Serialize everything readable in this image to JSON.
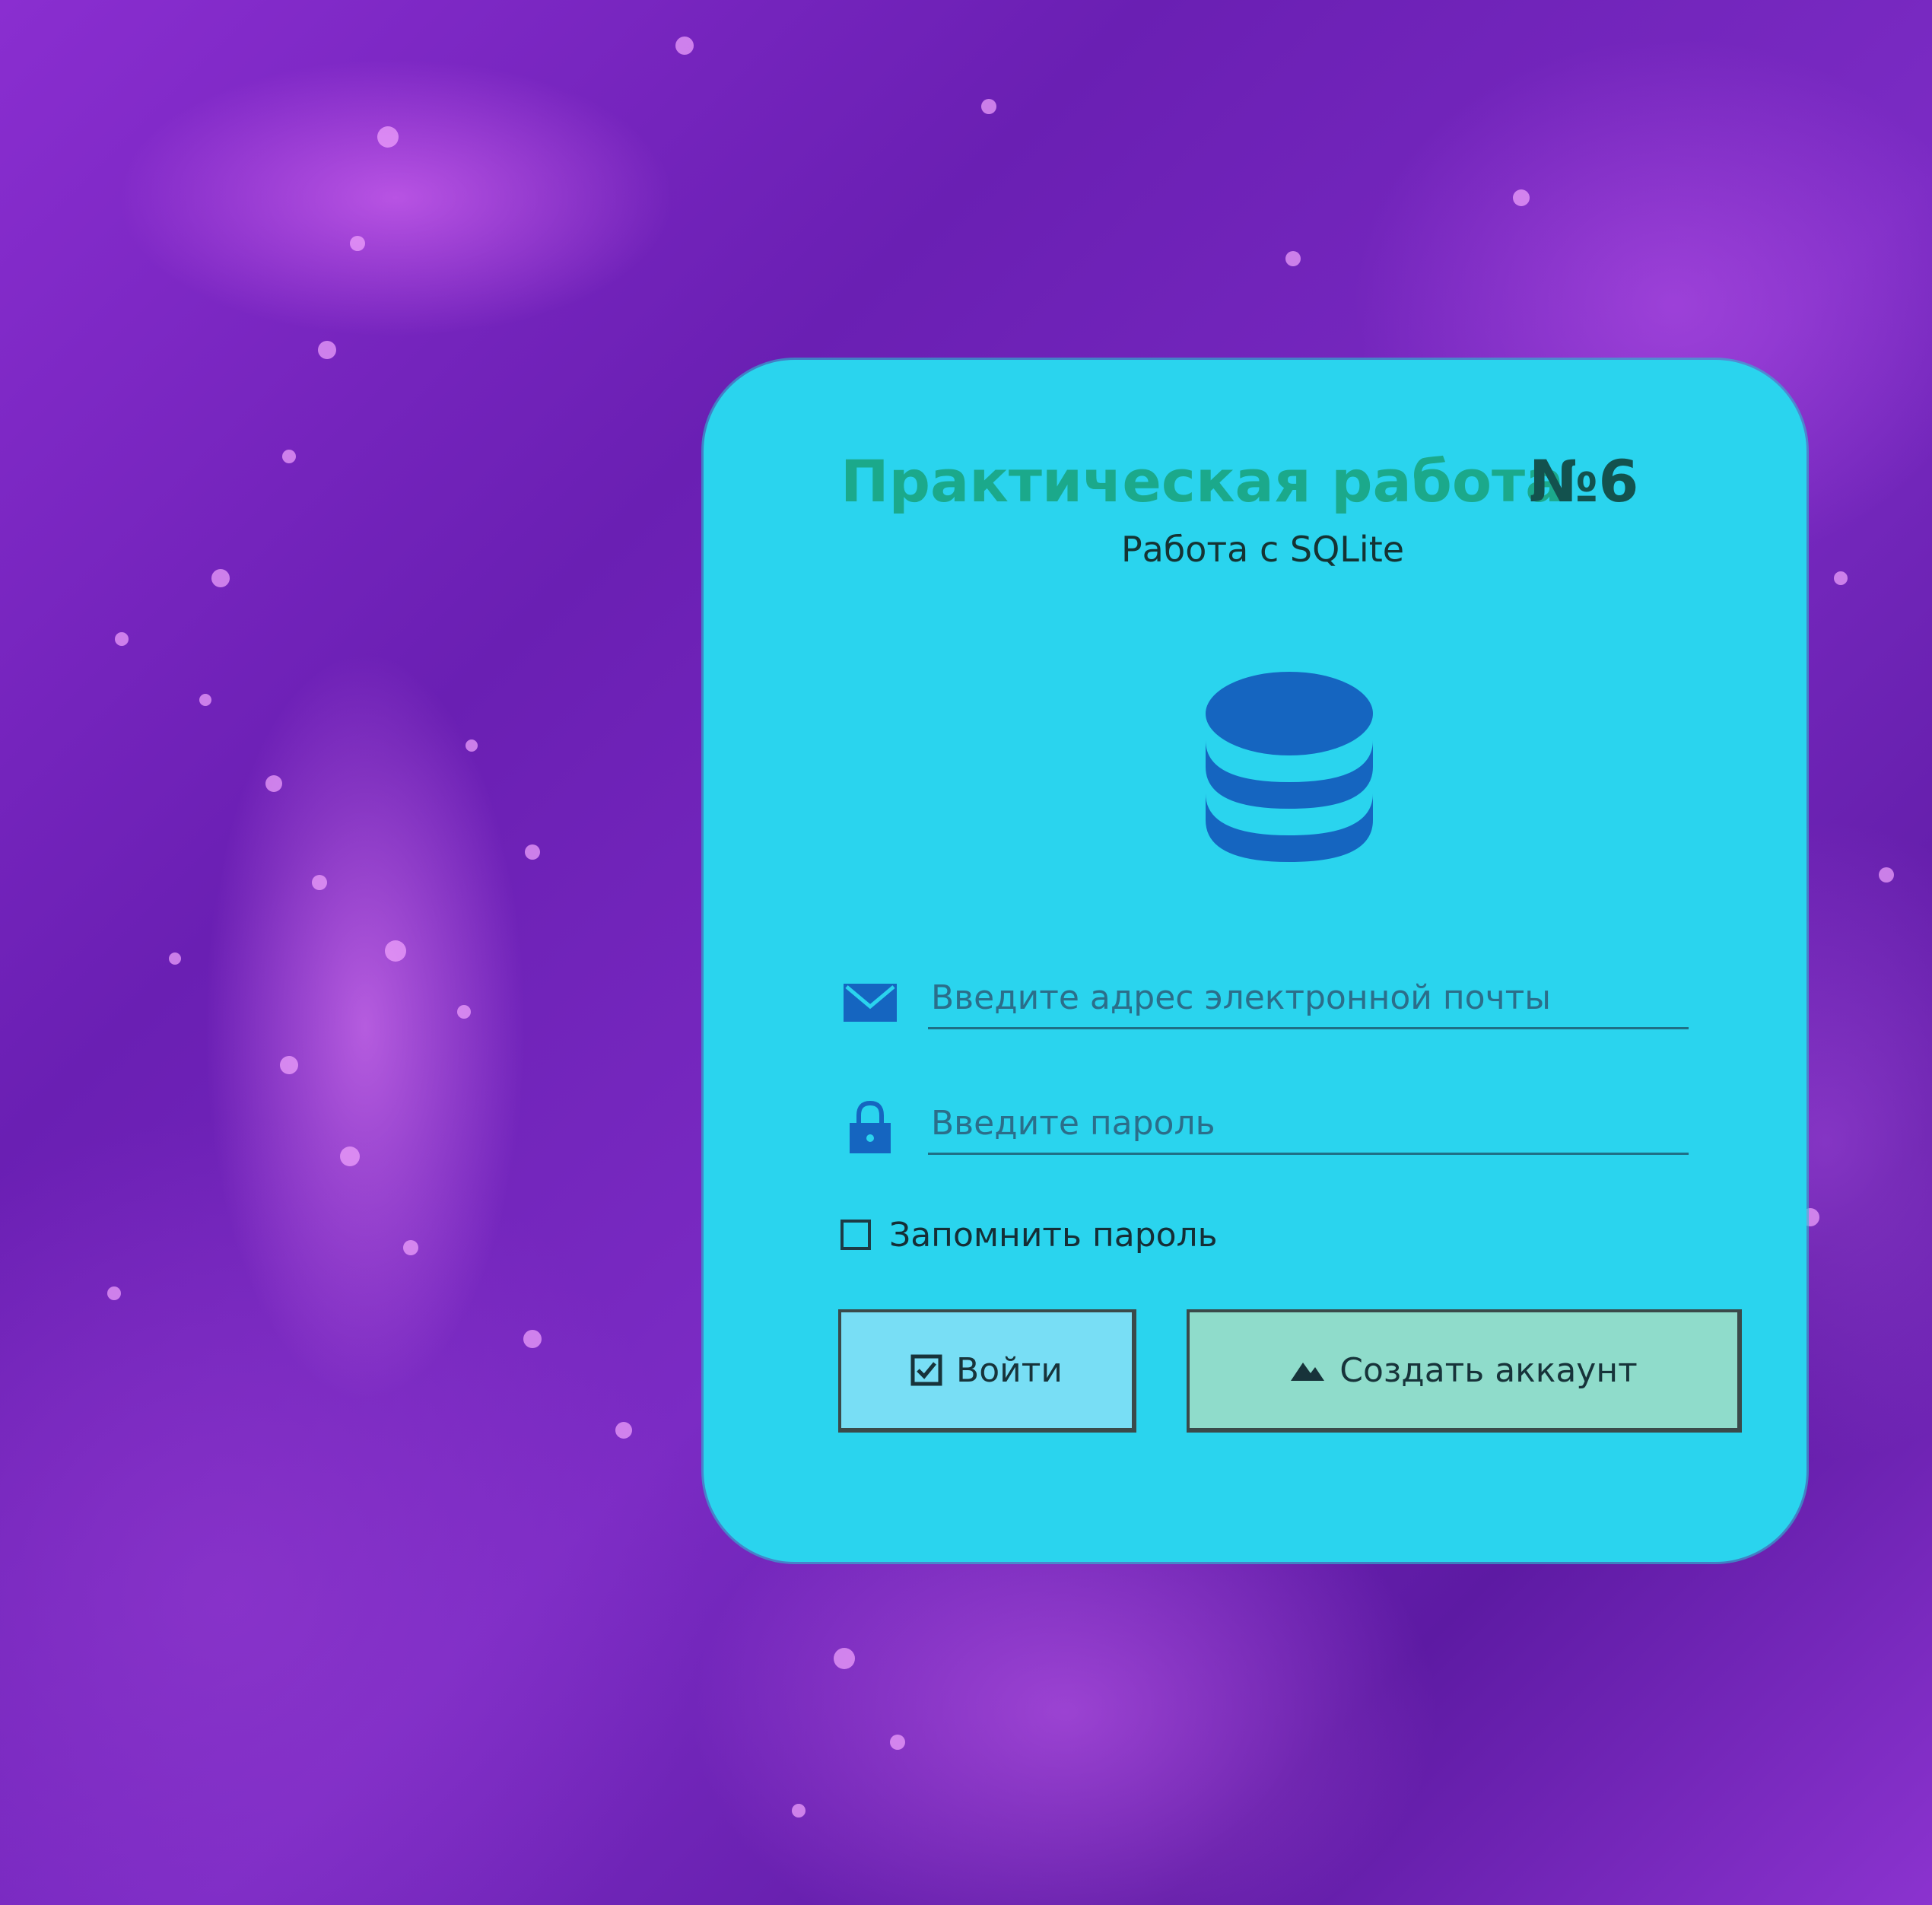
{
  "window": {
    "title": "Практическая работа",
    "title_number": "№6",
    "subtitle": "Работа с SQLite"
  },
  "icons": {
    "logo": "database-icon",
    "email": "envelope-icon",
    "password": "lock-icon",
    "login": "checkbox-arrow-icon",
    "create": "mountain-icon"
  },
  "form": {
    "email_placeholder": "Введите адрес электронной почты",
    "email_value": "",
    "password_placeholder": "Введите пароль",
    "password_value": "",
    "remember_label": "Запомнить пароль",
    "remember_checked": false,
    "login_label": "Войти",
    "create_label": "Создать аккаунт"
  },
  "colors": {
    "card_background": "#2ad4ee",
    "title": "#1ba98b",
    "title_number": "#13524e",
    "icon_blue": "#1565c0",
    "login_button": "#78def5",
    "create_button": "#8fdccb",
    "background": "#7b2bc4"
  }
}
